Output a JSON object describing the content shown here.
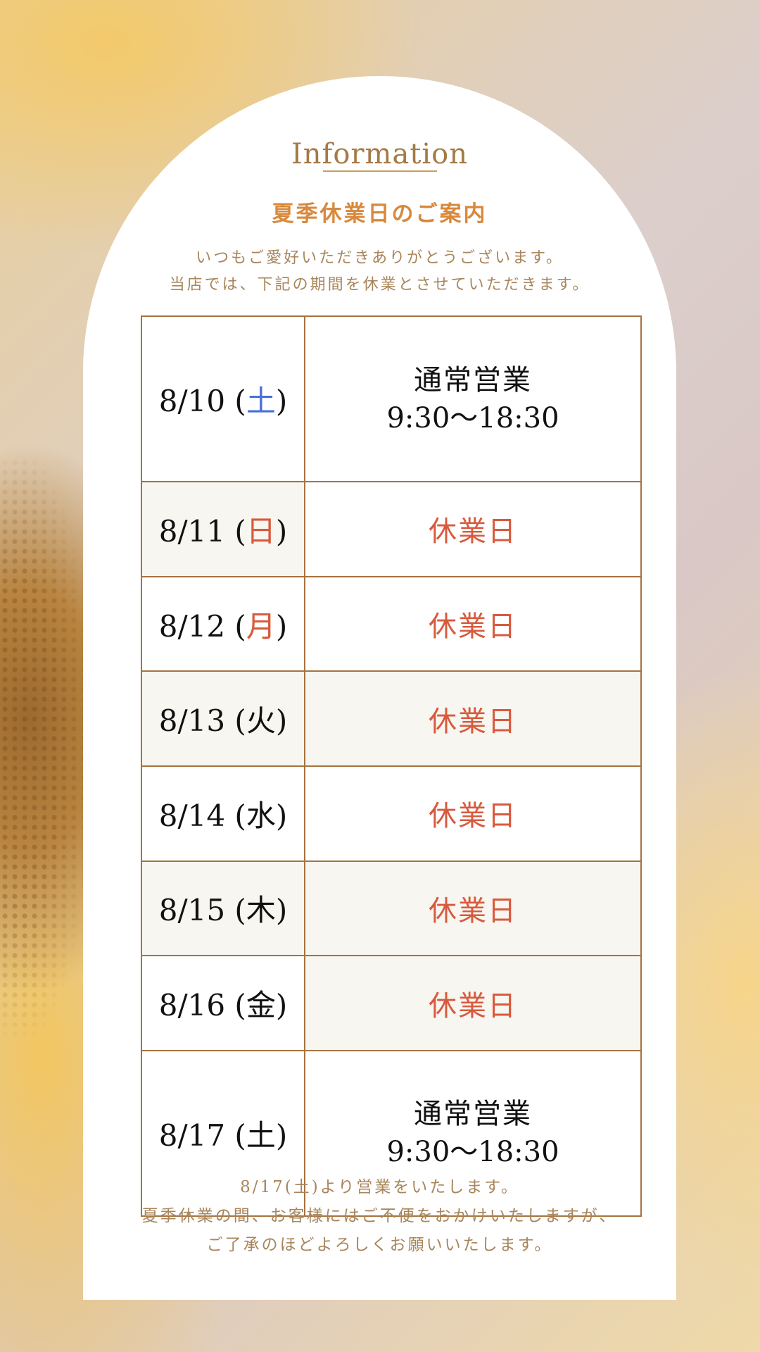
{
  "info_title": "Information",
  "heading": "夏季休業日のご案内",
  "intro_lines": [
    "いつもご愛好いただきありがとうございます。",
    "当店では、下記の期間を休業とさせていただきます。"
  ],
  "schedule": [
    {
      "date": "8/10",
      "weekday": "土",
      "weekday_color": "#4a6fd8",
      "status": "通常営業",
      "hours": "9:30〜18:30"
    },
    {
      "date": "8/11",
      "weekday": "日",
      "weekday_color": "#d85a3e",
      "status": "休業日"
    },
    {
      "date": "8/12",
      "weekday": "月",
      "weekday_color": "#d85a3e",
      "status": "休業日"
    },
    {
      "date": "8/13",
      "weekday": "火",
      "weekday_color": "#111111",
      "status": "休業日"
    },
    {
      "date": "8/14",
      "weekday": "水",
      "weekday_color": "#111111",
      "status": "休業日"
    },
    {
      "date": "8/15",
      "weekday": "木",
      "weekday_color": "#111111",
      "status": "休業日"
    },
    {
      "date": "8/16",
      "weekday": "金",
      "weekday_color": "#111111",
      "status": "休業日"
    },
    {
      "date": "8/17",
      "weekday": "土",
      "weekday_color": "#111111",
      "status": "通常営業",
      "hours": "9:30〜18:30"
    }
  ],
  "closing_lines": [
    "8/17(土)より営業をいたします。",
    "夏季休業の間、お客様にはご不便をおかけいたしますが、",
    "ご了承のほどよろしくお願いいたします。"
  ],
  "colors": {
    "accent": "#d8893c",
    "text_brown": "#a8855a",
    "border": "#a6733f",
    "closed": "#d85a3e",
    "saturday": "#4a6fd8"
  }
}
